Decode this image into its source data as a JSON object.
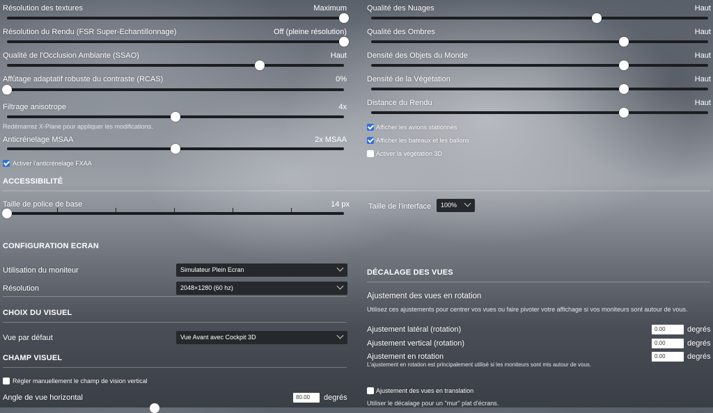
{
  "left_sliders": [
    {
      "label": "Résolution des textures",
      "value": "Maximum",
      "fraction": 1.0
    },
    {
      "label": "Résolution du Rendu (FSR Super-Echantillonnage)",
      "value": "Off (pleine résolution)",
      "fraction": 1.0
    },
    {
      "label": "Qualité de l'Occlusion Ambiante (SSAO)",
      "value": "Haut",
      "fraction": 0.75
    },
    {
      "label": "Affûtage adaptatif robuste du contraste (RCAS)",
      "value": "0%",
      "fraction": 0.0
    },
    {
      "label": "Filtrage anisotrope",
      "value": "4x",
      "fraction": 0.5
    },
    {
      "label": "Anticrénelage MSAA",
      "value": "2x MSAA",
      "fraction": 0.5
    }
  ],
  "restart_hint": "Redémarrez X-Plane pour appliquer les modifications.",
  "fxaa": {
    "label": "Activer l'anticrénelage FXAA",
    "checked": true
  },
  "right_sliders": [
    {
      "label": "Qualité des Nuages",
      "value": "Haut",
      "fraction": 0.67
    },
    {
      "label": "Qualité des Ombres",
      "value": "Haut",
      "fraction": 0.75
    },
    {
      "label": "Densité des Objets du Monde",
      "value": "Haut",
      "fraction": 0.75
    },
    {
      "label": "Densité de la Végétation",
      "value": "Haut",
      "fraction": 0.75
    },
    {
      "label": "Distance du Rendu",
      "value": "Haut",
      "fraction": 0.75
    }
  ],
  "right_checks": [
    {
      "label": "Afficher les avions stationnés",
      "checked": true
    },
    {
      "label": "Afficher les bateaux et les ballons",
      "checked": true
    },
    {
      "label": "Activer la végétation 3D",
      "checked": false
    }
  ],
  "accessibility": {
    "title": "ACCESSIBILITÉ",
    "font_label": "Taille de police de base",
    "font_value": "14 px",
    "font_fraction": 0.0,
    "ui_label": "Taille de l'interface",
    "ui_value": "100%"
  },
  "screen": {
    "title": "CONFIGURATION ECRAN",
    "monitor_label": "Utilisation du moniteur",
    "monitor_value": "Simulateur Plein Ecran",
    "resolution_label": "Résolution",
    "resolution_value": "2048×1280 (60 hz)"
  },
  "visual": {
    "title": "CHOIX DU VISUEL",
    "default_label": "Vue par défaut",
    "default_value": "Vue Avant avec Cockpit 3D"
  },
  "fov": {
    "title": "CHAMP VISUEL",
    "manual_label": "Régler manuellement le champ de vision vertical",
    "manual_checked": false,
    "horizontal_label": "Angle de vue horizontal",
    "horizontal_value": "80.00",
    "unit": "degrés"
  },
  "offsets": {
    "title": "DÉCALAGE DES VUES",
    "rotation_title": "Ajustement des vues en rotation",
    "rotation_desc": "Utilisez ces ajustements pour centrer vos vues ou faire pivoter votre affichage si vos moniteurs sont autour de vous.",
    "rows": [
      {
        "label": "Ajustement latéral (rotation)",
        "value": "0.00",
        "unit": "degrés"
      },
      {
        "label": "Ajustement vertical (rotation)",
        "value": "0.00",
        "unit": "degrés"
      },
      {
        "label": "Ajustement en rotation",
        "value": "0.00",
        "unit": "degrés"
      }
    ],
    "rotation_note": "L'ajustement en rotation est principalement utilisé si les moniteurs sont mis autour de vous.",
    "translation_label": "Ajustement des vues en translation",
    "translation_checked": false,
    "translation_desc": "Utiliser le décalage pour un \"mur\" plat d'écrans."
  }
}
